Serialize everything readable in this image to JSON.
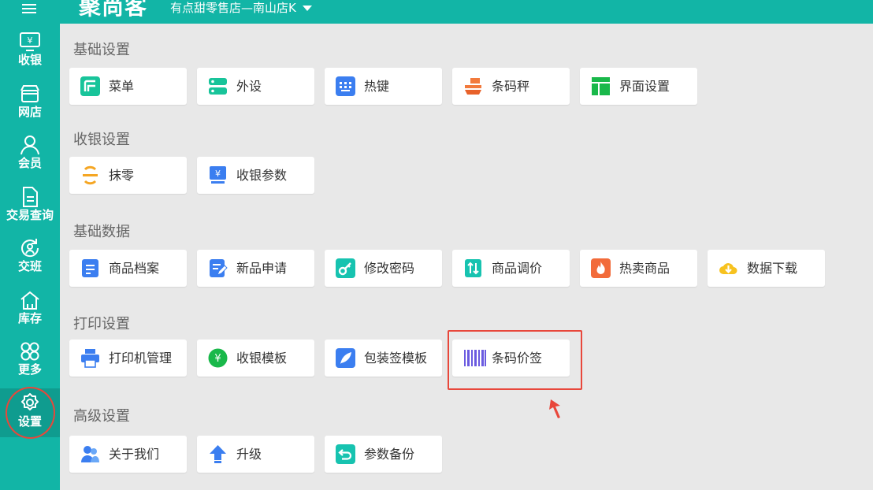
{
  "header": {
    "logo_text": "聚尚客",
    "store_name": "有点甜零售店—南山店K"
  },
  "sidebar": {
    "items": [
      {
        "label": "收银",
        "icon": "cashier-icon"
      },
      {
        "label": "网店",
        "icon": "store-icon"
      },
      {
        "label": "会员",
        "icon": "member-icon"
      },
      {
        "label": "交易查询",
        "icon": "transaction-query-icon"
      },
      {
        "label": "交班",
        "icon": "shift-handover-icon"
      },
      {
        "label": "库存",
        "icon": "inventory-icon"
      },
      {
        "label": "更多",
        "icon": "more-icon"
      },
      {
        "label": "设置",
        "icon": "settings-icon",
        "active": true
      }
    ]
  },
  "sections": [
    {
      "title": "基础设置",
      "tiles": [
        {
          "label": "菜单",
          "icon": "menu-icon"
        },
        {
          "label": "外设",
          "icon": "peripheral-icon"
        },
        {
          "label": "热键",
          "icon": "hotkey-icon"
        },
        {
          "label": "条码秤",
          "icon": "barcode-scale-icon"
        },
        {
          "label": "界面设置",
          "icon": "interface-icon"
        }
      ]
    },
    {
      "title": "收银设置",
      "tiles": [
        {
          "label": "抹零",
          "icon": "rounding-icon"
        },
        {
          "label": "收银参数",
          "icon": "cashier-params-icon"
        }
      ]
    },
    {
      "title": "基础数据",
      "tiles": [
        {
          "label": "商品档案",
          "icon": "product-file-icon"
        },
        {
          "label": "新品申请",
          "icon": "new-product-icon"
        },
        {
          "label": "修改密码",
          "icon": "change-password-icon"
        },
        {
          "label": "商品调价",
          "icon": "price-adjust-icon"
        },
        {
          "label": "热卖商品",
          "icon": "hot-sale-icon"
        },
        {
          "label": "数据下载",
          "icon": "data-download-icon"
        }
      ]
    },
    {
      "title": "打印设置",
      "tiles": [
        {
          "label": "打印机管理",
          "icon": "printer-icon"
        },
        {
          "label": "收银模板",
          "icon": "cashier-template-icon"
        },
        {
          "label": "包装签模板",
          "icon": "package-label-icon"
        },
        {
          "label": "条码价签",
          "icon": "barcode-price-tag-icon"
        }
      ]
    },
    {
      "title": "高级设置",
      "tiles": [
        {
          "label": "关于我们",
          "icon": "about-icon"
        },
        {
          "label": "升级",
          "icon": "upgrade-icon"
        },
        {
          "label": "参数备份",
          "icon": "backup-icon"
        }
      ]
    }
  ],
  "colors": {
    "accent": "#12b5a6",
    "highlight": "#e8473b",
    "background": "#e8e8e8"
  }
}
